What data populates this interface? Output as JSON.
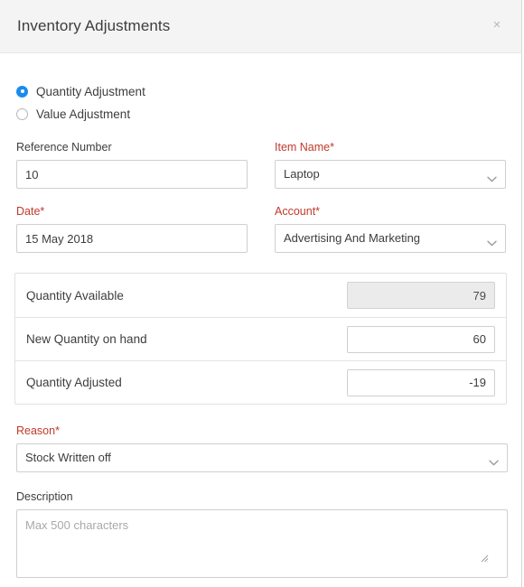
{
  "header": {
    "title": "Inventory Adjustments",
    "close_label": "×"
  },
  "adjustment_type": {
    "options": [
      {
        "label": "Quantity Adjustment",
        "selected": true
      },
      {
        "label": "Value Adjustment",
        "selected": false
      }
    ]
  },
  "fields": {
    "reference_number": {
      "label": "Reference Number",
      "value": "10",
      "required": false
    },
    "item_name": {
      "label": "Item Name",
      "required_mark": "*",
      "value": "Laptop",
      "required": true
    },
    "date": {
      "label": "Date",
      "required_mark": "*",
      "value": "15 May 2018",
      "required": true
    },
    "account": {
      "label": "Account",
      "required_mark": "*",
      "value": "Advertising And Marketing",
      "required": true
    },
    "reason": {
      "label": "Reason",
      "required_mark": "*",
      "value": "Stock Written off",
      "required": true
    },
    "description": {
      "label": "Description",
      "value": "",
      "placeholder": "Max 500 characters"
    }
  },
  "quantity_table": {
    "rows": [
      {
        "name": "Quantity Available",
        "value": "79",
        "editable": false
      },
      {
        "name": "New Quantity on hand",
        "value": "60",
        "editable": true
      },
      {
        "name": "Quantity Adjusted",
        "value": "-19",
        "editable": true
      }
    ]
  },
  "icons": {
    "chevron_down": "chevron-down-icon",
    "close": "close-icon",
    "resize_grip": "resize-grip-icon"
  },
  "colors": {
    "accent_blue": "#1a8cf0",
    "required_red": "#c0392b",
    "header_bg": "#f4f4f4",
    "border": "#cfcfcf",
    "disabled_bg": "#ebebeb"
  }
}
